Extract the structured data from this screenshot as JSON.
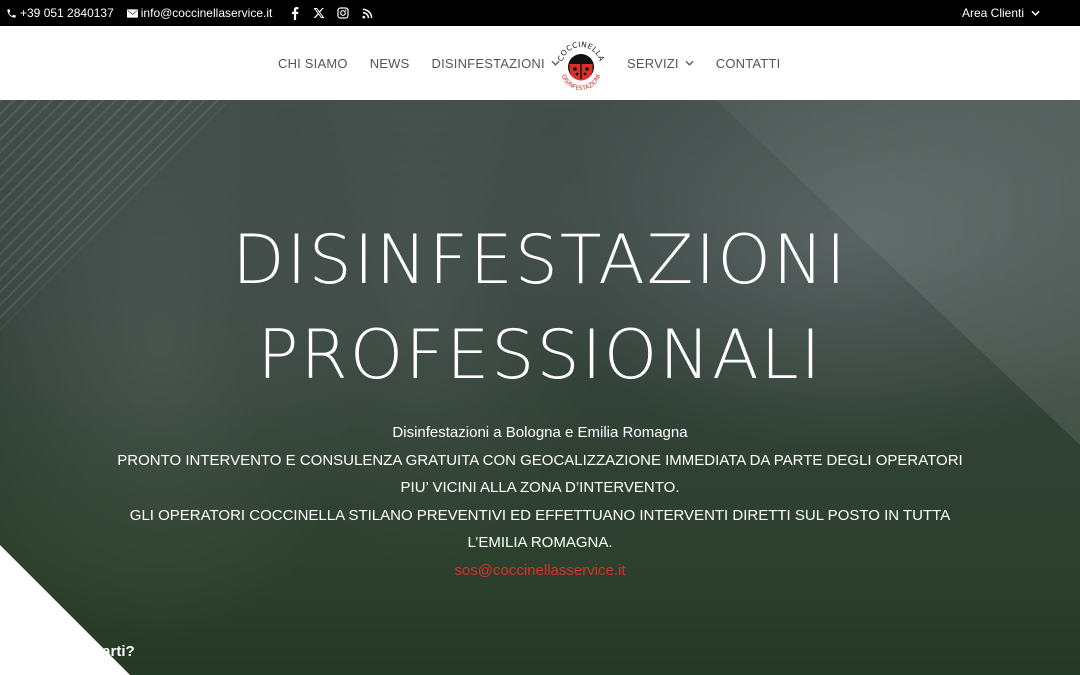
{
  "topbar": {
    "phone": "+39 051 2840137",
    "email": "info@coccinellaservice.it",
    "social_icons": [
      "facebook-icon",
      "x-icon",
      "instagram-icon",
      "rss-icon"
    ],
    "area_clienti": "Area Clienti"
  },
  "nav": {
    "items": [
      {
        "label": "CHI SIAMO"
      },
      {
        "label": "NEWS"
      },
      {
        "label": "DISINFESTAZIONI",
        "has_dropdown": true
      },
      {
        "label": "SERVIZI",
        "has_dropdown": true
      },
      {
        "label": "CONTATTI"
      }
    ],
    "logo": {
      "top_text": "COCCINELLA",
      "bottom_text": "DISINFESTAZIONI"
    }
  },
  "hero": {
    "title_line1": "DISINFESTAZIONI",
    "title_line2": "PROFESSIONALI",
    "subtitle": "Disinfestazioni a Bologna e Emilia Romagna",
    "line1": "PRONTO INTERVENTO E CONSULENZA GRATUITA CON GEOCALIZZAZIONE IMMEDIATA DA PARTE DEGLI OPERATORI",
    "line2": "PIU’ VICINI ALLA ZONA D’INTERVENTO.",
    "line3": "GLI OPERATORI COCCINELLA STILANO PREVENTIVI ED EFFETTUANO INTERVENTI DIRETTI SUL POSTO IN TUTTA",
    "line4": "L’EMILIA ROMAGNA.",
    "email": "sos@coccinellasservice.it",
    "help_text": "utarti?"
  },
  "colors": {
    "accent_red": "#d9312a",
    "topbar_bg": "#000000",
    "nav_text": "#555555"
  }
}
